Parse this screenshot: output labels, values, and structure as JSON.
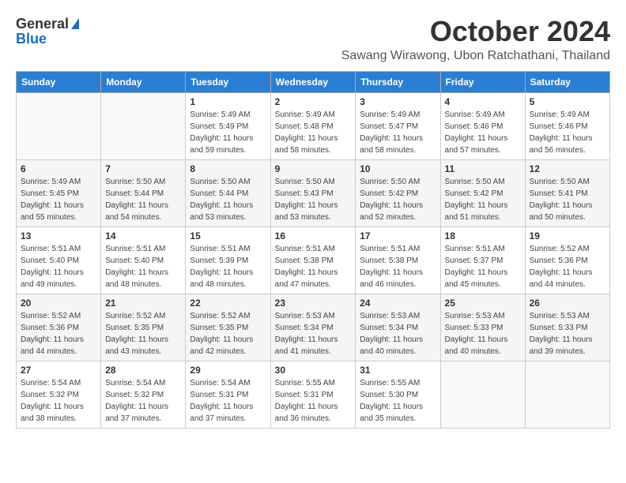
{
  "header": {
    "logo_line1": "General",
    "logo_line2": "Blue",
    "month_title": "October 2024",
    "location": "Sawang Wirawong, Ubon Ratchathani, Thailand"
  },
  "weekdays": [
    "Sunday",
    "Monday",
    "Tuesday",
    "Wednesday",
    "Thursday",
    "Friday",
    "Saturday"
  ],
  "weeks": [
    [
      {
        "day": "",
        "sunrise": "",
        "sunset": "",
        "daylight": ""
      },
      {
        "day": "",
        "sunrise": "",
        "sunset": "",
        "daylight": ""
      },
      {
        "day": "1",
        "sunrise": "Sunrise: 5:49 AM",
        "sunset": "Sunset: 5:49 PM",
        "daylight": "Daylight: 11 hours and 59 minutes."
      },
      {
        "day": "2",
        "sunrise": "Sunrise: 5:49 AM",
        "sunset": "Sunset: 5:48 PM",
        "daylight": "Daylight: 11 hours and 58 minutes."
      },
      {
        "day": "3",
        "sunrise": "Sunrise: 5:49 AM",
        "sunset": "Sunset: 5:47 PM",
        "daylight": "Daylight: 11 hours and 58 minutes."
      },
      {
        "day": "4",
        "sunrise": "Sunrise: 5:49 AM",
        "sunset": "Sunset: 5:46 PM",
        "daylight": "Daylight: 11 hours and 57 minutes."
      },
      {
        "day": "5",
        "sunrise": "Sunrise: 5:49 AM",
        "sunset": "Sunset: 5:46 PM",
        "daylight": "Daylight: 11 hours and 56 minutes."
      }
    ],
    [
      {
        "day": "6",
        "sunrise": "Sunrise: 5:49 AM",
        "sunset": "Sunset: 5:45 PM",
        "daylight": "Daylight: 11 hours and 55 minutes."
      },
      {
        "day": "7",
        "sunrise": "Sunrise: 5:50 AM",
        "sunset": "Sunset: 5:44 PM",
        "daylight": "Daylight: 11 hours and 54 minutes."
      },
      {
        "day": "8",
        "sunrise": "Sunrise: 5:50 AM",
        "sunset": "Sunset: 5:44 PM",
        "daylight": "Daylight: 11 hours and 53 minutes."
      },
      {
        "day": "9",
        "sunrise": "Sunrise: 5:50 AM",
        "sunset": "Sunset: 5:43 PM",
        "daylight": "Daylight: 11 hours and 53 minutes."
      },
      {
        "day": "10",
        "sunrise": "Sunrise: 5:50 AM",
        "sunset": "Sunset: 5:42 PM",
        "daylight": "Daylight: 11 hours and 52 minutes."
      },
      {
        "day": "11",
        "sunrise": "Sunrise: 5:50 AM",
        "sunset": "Sunset: 5:42 PM",
        "daylight": "Daylight: 11 hours and 51 minutes."
      },
      {
        "day": "12",
        "sunrise": "Sunrise: 5:50 AM",
        "sunset": "Sunset: 5:41 PM",
        "daylight": "Daylight: 11 hours and 50 minutes."
      }
    ],
    [
      {
        "day": "13",
        "sunrise": "Sunrise: 5:51 AM",
        "sunset": "Sunset: 5:40 PM",
        "daylight": "Daylight: 11 hours and 49 minutes."
      },
      {
        "day": "14",
        "sunrise": "Sunrise: 5:51 AM",
        "sunset": "Sunset: 5:40 PM",
        "daylight": "Daylight: 11 hours and 48 minutes."
      },
      {
        "day": "15",
        "sunrise": "Sunrise: 5:51 AM",
        "sunset": "Sunset: 5:39 PM",
        "daylight": "Daylight: 11 hours and 48 minutes."
      },
      {
        "day": "16",
        "sunrise": "Sunrise: 5:51 AM",
        "sunset": "Sunset: 5:38 PM",
        "daylight": "Daylight: 11 hours and 47 minutes."
      },
      {
        "day": "17",
        "sunrise": "Sunrise: 5:51 AM",
        "sunset": "Sunset: 5:38 PM",
        "daylight": "Daylight: 11 hours and 46 minutes."
      },
      {
        "day": "18",
        "sunrise": "Sunrise: 5:51 AM",
        "sunset": "Sunset: 5:37 PM",
        "daylight": "Daylight: 11 hours and 45 minutes."
      },
      {
        "day": "19",
        "sunrise": "Sunrise: 5:52 AM",
        "sunset": "Sunset: 5:36 PM",
        "daylight": "Daylight: 11 hours and 44 minutes."
      }
    ],
    [
      {
        "day": "20",
        "sunrise": "Sunrise: 5:52 AM",
        "sunset": "Sunset: 5:36 PM",
        "daylight": "Daylight: 11 hours and 44 minutes."
      },
      {
        "day": "21",
        "sunrise": "Sunrise: 5:52 AM",
        "sunset": "Sunset: 5:35 PM",
        "daylight": "Daylight: 11 hours and 43 minutes."
      },
      {
        "day": "22",
        "sunrise": "Sunrise: 5:52 AM",
        "sunset": "Sunset: 5:35 PM",
        "daylight": "Daylight: 11 hours and 42 minutes."
      },
      {
        "day": "23",
        "sunrise": "Sunrise: 5:53 AM",
        "sunset": "Sunset: 5:34 PM",
        "daylight": "Daylight: 11 hours and 41 minutes."
      },
      {
        "day": "24",
        "sunrise": "Sunrise: 5:53 AM",
        "sunset": "Sunset: 5:34 PM",
        "daylight": "Daylight: 11 hours and 40 minutes."
      },
      {
        "day": "25",
        "sunrise": "Sunrise: 5:53 AM",
        "sunset": "Sunset: 5:33 PM",
        "daylight": "Daylight: 11 hours and 40 minutes."
      },
      {
        "day": "26",
        "sunrise": "Sunrise: 5:53 AM",
        "sunset": "Sunset: 5:33 PM",
        "daylight": "Daylight: 11 hours and 39 minutes."
      }
    ],
    [
      {
        "day": "27",
        "sunrise": "Sunrise: 5:54 AM",
        "sunset": "Sunset: 5:32 PM",
        "daylight": "Daylight: 11 hours and 38 minutes."
      },
      {
        "day": "28",
        "sunrise": "Sunrise: 5:54 AM",
        "sunset": "Sunset: 5:32 PM",
        "daylight": "Daylight: 11 hours and 37 minutes."
      },
      {
        "day": "29",
        "sunrise": "Sunrise: 5:54 AM",
        "sunset": "Sunset: 5:31 PM",
        "daylight": "Daylight: 11 hours and 37 minutes."
      },
      {
        "day": "30",
        "sunrise": "Sunrise: 5:55 AM",
        "sunset": "Sunset: 5:31 PM",
        "daylight": "Daylight: 11 hours and 36 minutes."
      },
      {
        "day": "31",
        "sunrise": "Sunrise: 5:55 AM",
        "sunset": "Sunset: 5:30 PM",
        "daylight": "Daylight: 11 hours and 35 minutes."
      },
      {
        "day": "",
        "sunrise": "",
        "sunset": "",
        "daylight": ""
      },
      {
        "day": "",
        "sunrise": "",
        "sunset": "",
        "daylight": ""
      }
    ]
  ]
}
